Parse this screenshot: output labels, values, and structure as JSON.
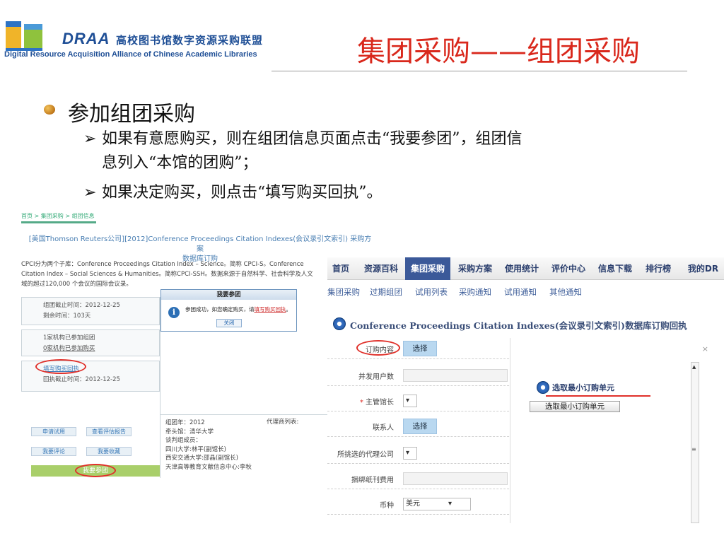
{
  "header": {
    "logo_text": "DRAA",
    "logo_cn": "高校图书馆数字资源采购联盟",
    "logo_en": "Digital Resource Acquisition Alliance of Chinese Academic Libraries",
    "title": "集团采购——组团采购"
  },
  "bullets": {
    "main": "参加组团采购",
    "arrow": "➢",
    "sub1_line1": "如果有意愿购买，则在组团信息页面点击“我要参团”，组团信",
    "sub1_line2": "息列入“本馆的团购”；",
    "sub2": "如果决定购买，则点击“填写购买回执”。"
  },
  "left_shot": {
    "breadcrumb": "首页 > 集团采购 > 组团信息",
    "heading_line1": "[美国Thomson Reuters公司][2012]Conference Proceedings Citation Indexes(会议录引文索引) 采购方案",
    "heading_line2": "数据库订购",
    "desc_line1": "CPCI分为两个子库：Conference Proceedings Citation Index – Science。简称 CPCI-S。Conference",
    "desc_line2": "Citation Index – Social Sciences & Humanities。简称CPCI-SSH。数据来源于自然科学、社会科学及人文",
    "desc_line3": "域的超过120,000 个会议的国际会议录。",
    "deadline": "组团截止时间：2012-12-25",
    "remaining": "剩余时间：103天",
    "joined": "1家机构已参加组团",
    "bought": "0家机构已参加购买",
    "fill_receipt": "填写购买回执",
    "receipt_deadline": "回执截止时间：2012-12-25",
    "btn_trial": "申请试用",
    "btn_report": "查看评估报告",
    "btn_comment": "我要评论",
    "btn_fav": "我要收藏",
    "btn_join": "我要参团",
    "group_year": "组团年：2012",
    "lead": "牵头馆：清华大学",
    "members_label": "谈判组成员：",
    "member1": "四川大学:林平(副馆长)",
    "member2": "西安交通大学:邵晶(副馆长)",
    "member3": "天津高等教育文献信息中心:李秋",
    "vendors": "代理商列表:",
    "dialog_title": "我要参团",
    "dialog_text_a": "参团成功，如您确定购买，请",
    "dialog_text_link": "填写购买回执",
    "dialog_text_b": "。",
    "dialog_btn": "关闭"
  },
  "right_shot": {
    "nav": [
      "首页",
      "资源百科",
      "集团采购",
      "采购方案",
      "使用统计",
      "评价中心",
      "信息下载",
      "排行榜",
      "我的DR"
    ],
    "subnav": [
      "集团采购",
      "过期组团",
      "试用列表",
      "采购通知",
      "试用通知",
      "其他通知"
    ],
    "form_title": "Conference Proceedings Citation Indexes(会议录引文索引)数据库订购回执",
    "rows": {
      "order_content": "订购内容",
      "concurrent": "并发用户数",
      "required_mark": "*",
      "director": "主管馆长",
      "contact": "联系人",
      "agent": "所挑选的代理公司",
      "binding": "捆绑纸刊费用",
      "currency": "币种",
      "currency_value": "美元",
      "select_btn": "选择"
    },
    "popup_title": "选取最小订购单元",
    "popup_btn": "选取最小订购单元",
    "close": "×"
  }
}
